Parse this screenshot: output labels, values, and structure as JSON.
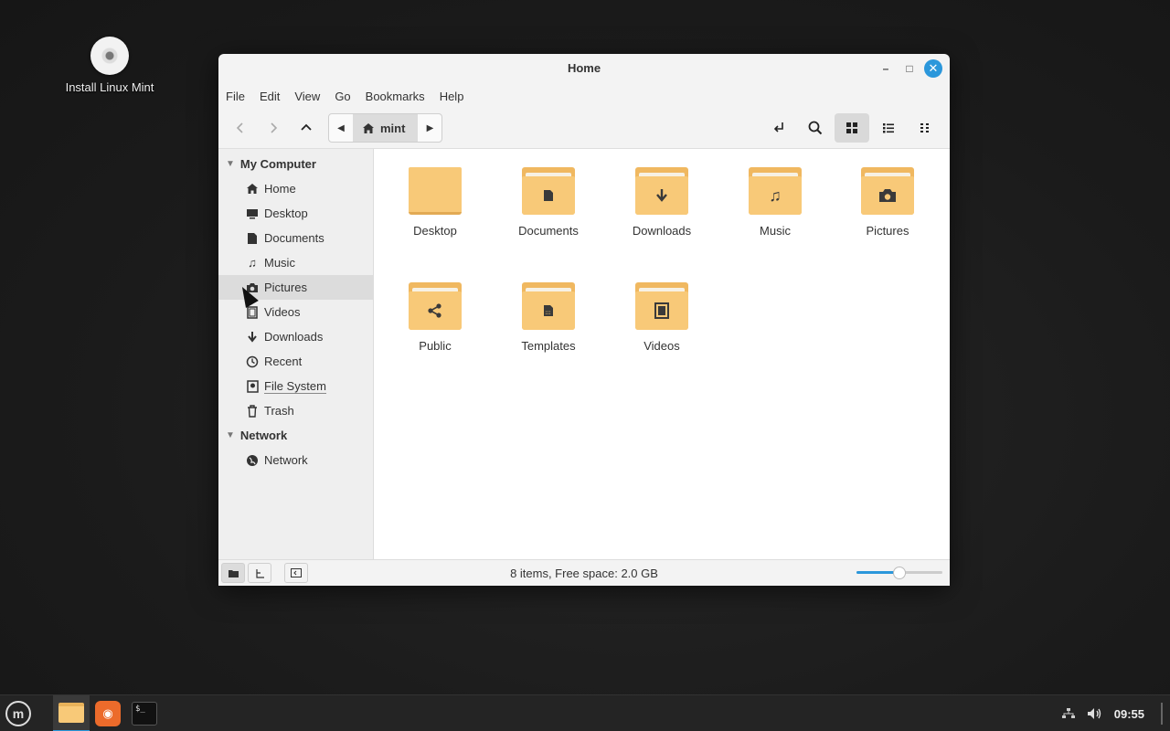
{
  "desktop": {
    "icon_label": "Install Linux Mint"
  },
  "window": {
    "title": "Home",
    "menu": [
      "File",
      "Edit",
      "View",
      "Go",
      "Bookmarks",
      "Help"
    ],
    "path": {
      "crumb": "mint"
    }
  },
  "sidebar": {
    "sections": [
      {
        "title": "My Computer",
        "items": [
          {
            "label": "Home",
            "icon": "home-icon"
          },
          {
            "label": "Desktop",
            "icon": "desktop-icon"
          },
          {
            "label": "Documents",
            "icon": "document-icon"
          },
          {
            "label": "Music",
            "icon": "music-icon"
          },
          {
            "label": "Pictures",
            "icon": "camera-icon"
          },
          {
            "label": "Videos",
            "icon": "film-icon"
          },
          {
            "label": "Downloads",
            "icon": "download-icon"
          },
          {
            "label": "Recent",
            "icon": "clock-icon"
          },
          {
            "label": "File System",
            "icon": "drive-icon"
          },
          {
            "label": "Trash",
            "icon": "trash-icon"
          }
        ]
      },
      {
        "title": "Network",
        "items": [
          {
            "label": "Network",
            "icon": "globe-icon"
          }
        ]
      }
    ]
  },
  "files": [
    {
      "label": "Desktop",
      "icon": "folder-icon"
    },
    {
      "label": "Documents",
      "icon": "folder-documents-icon"
    },
    {
      "label": "Downloads",
      "icon": "folder-download-icon"
    },
    {
      "label": "Music",
      "icon": "folder-music-icon"
    },
    {
      "label": "Pictures",
      "icon": "folder-pictures-icon"
    },
    {
      "label": "Public",
      "icon": "folder-share-icon"
    },
    {
      "label": "Templates",
      "icon": "folder-templates-icon"
    },
    {
      "label": "Videos",
      "icon": "folder-videos-icon"
    }
  ],
  "status": {
    "text": "8 items, Free space: 2.0 GB",
    "zoom_level": 0.5
  },
  "taskbar": {
    "clock": "09:55"
  },
  "colors": {
    "accent": "#2b97db",
    "folder": "#f8c978"
  }
}
